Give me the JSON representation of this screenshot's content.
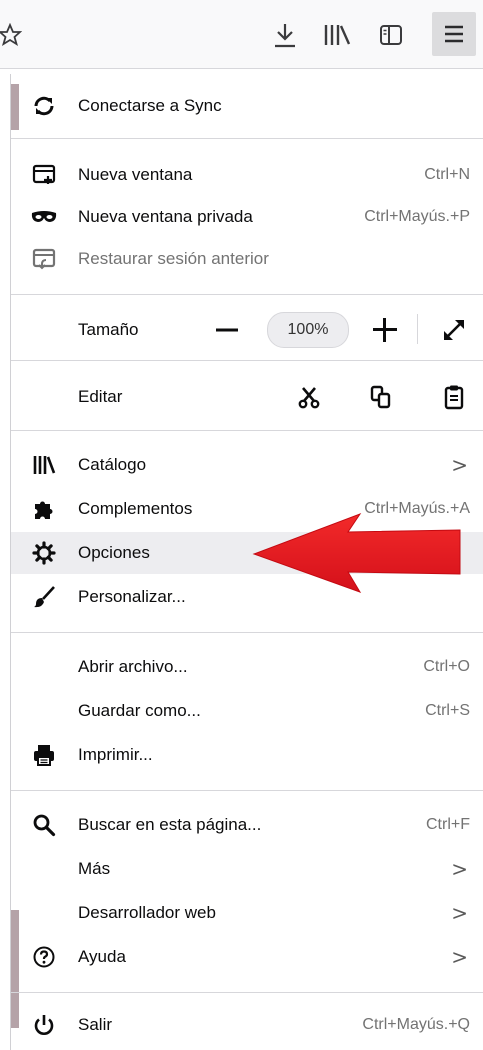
{
  "menu": {
    "sync": {
      "label": "Conectarse a Sync"
    },
    "new_window": {
      "label": "Nueva ventana",
      "shortcut": "Ctrl+N"
    },
    "private_window": {
      "label": "Nueva ventana privada",
      "shortcut": "Ctrl+Mayús.+P"
    },
    "restore_session": {
      "label": "Restaurar sesión anterior"
    },
    "zoom": {
      "label": "Tamaño",
      "value": "100%"
    },
    "edit": {
      "label": "Editar"
    },
    "library": {
      "label": "Catálogo"
    },
    "addons": {
      "label": "Complementos",
      "shortcut": "Ctrl+Mayús.+A"
    },
    "options": {
      "label": "Opciones"
    },
    "customize": {
      "label": "Personalizar..."
    },
    "open_file": {
      "label": "Abrir archivo...",
      "shortcut": "Ctrl+O"
    },
    "save_as": {
      "label": "Guardar como...",
      "shortcut": "Ctrl+S"
    },
    "print": {
      "label": "Imprimir..."
    },
    "find": {
      "label": "Buscar en esta página...",
      "shortcut": "Ctrl+F"
    },
    "more": {
      "label": "Más",
      "chevron": ">"
    },
    "web_developer": {
      "label": "Desarrollador web",
      "chevron": ">"
    },
    "help": {
      "label": "Ayuda",
      "chevron": ">"
    },
    "quit": {
      "label": "Salir",
      "shortcut": "Ctrl+Mayús.+Q"
    },
    "library_chevron": ">"
  },
  "icons": {
    "toolbar": [
      "star-icon",
      "download-icon",
      "library-icon",
      "sidebar-icon",
      "hamburger-menu-icon"
    ],
    "annotation": "red-arrow"
  },
  "colors": {
    "arrow": "#e5141b",
    "hover_row": "#ededf0",
    "shortcut_text": "#737373"
  }
}
